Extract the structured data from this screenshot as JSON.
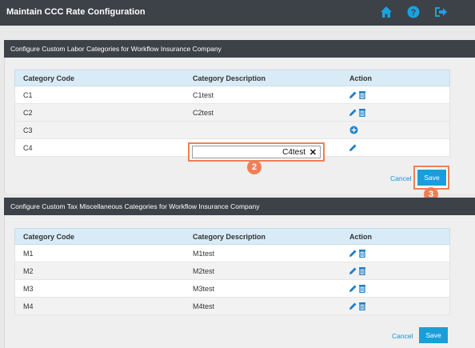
{
  "header": {
    "title": "Maintain CCC Rate Configuration"
  },
  "icons": {
    "home": "home-icon",
    "help": "help-icon",
    "logout": "logout-icon"
  },
  "colors": {
    "accent": "#1a9edb",
    "topbar": "#3d4148",
    "grid_header": "#d8ebf6",
    "highlight": "#ef7f57"
  },
  "labor": {
    "section_title": "Configure Custom Labor Categories for Workflow Insurance Company",
    "columns": [
      "Category Code",
      "Category Description",
      "Action"
    ],
    "rows": [
      {
        "code": "C1",
        "description": "C1test",
        "actions": "edit-delete"
      },
      {
        "code": "C2",
        "description": "C2test",
        "actions": "edit-delete"
      },
      {
        "code": "C3",
        "description": "",
        "actions": "add"
      },
      {
        "code": "C4",
        "description": "C4test",
        "actions": "edit",
        "editing": true
      }
    ],
    "edit_value": "C4test",
    "cancel_label": "Cancel",
    "save_label": "Save"
  },
  "tax": {
    "section_title": "Configure Custom Tax Miscellaneous Categories for Workflow Insurance Company",
    "columns": [
      "Category Code",
      "Category Description",
      "Action"
    ],
    "rows": [
      {
        "code": "M1",
        "description": "M1test",
        "actions": "edit-delete"
      },
      {
        "code": "M2",
        "description": "M2test",
        "actions": "edit-delete"
      },
      {
        "code": "M3",
        "description": "M3test",
        "actions": "edit-delete"
      },
      {
        "code": "M4",
        "description": "M4test",
        "actions": "edit-delete"
      }
    ],
    "cancel_label": "Cancel",
    "save_label": "Save"
  },
  "callouts": {
    "step2": "2",
    "step3": "3"
  }
}
